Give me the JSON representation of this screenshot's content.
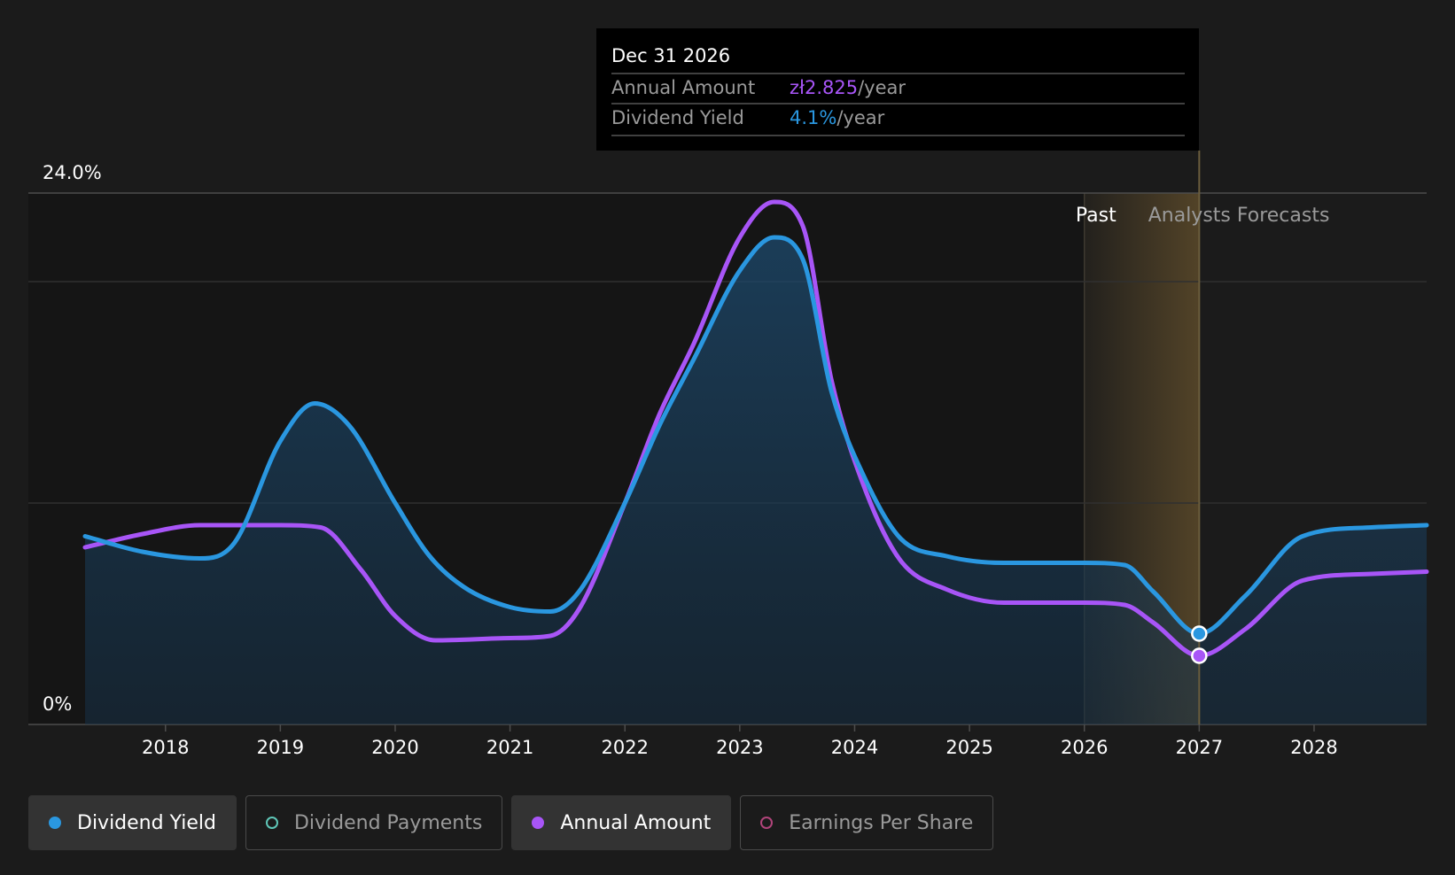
{
  "tooltip": {
    "date": "Dec 31 2026",
    "rows": [
      {
        "label": "Annual Amount",
        "value": "zł2.825",
        "unit": "/year",
        "color": "#a855f7"
      },
      {
        "label": "Dividend Yield",
        "value": "4.1%",
        "unit": "/year",
        "color": "#2a97e0"
      }
    ]
  },
  "regions": {
    "past_label": "Past",
    "forecast_label": "Analysts Forecasts"
  },
  "legend": [
    {
      "label": "Dividend Yield",
      "color": "#2a97e0",
      "style": "filled",
      "active": true
    },
    {
      "label": "Dividend Payments",
      "color": "#5fc7b8",
      "style": "hollow",
      "active": false
    },
    {
      "label": "Annual Amount",
      "color": "#a855f7",
      "style": "filled",
      "active": true
    },
    {
      "label": "Earnings Per Share",
      "color": "#b0447a",
      "style": "hollow",
      "active": false
    }
  ],
  "colors": {
    "dividend_yield": "#2a97e0",
    "annual_amount": "#a855f7",
    "background": "#1b1b1b",
    "forecast_band": "#5c4a2a"
  },
  "chart_data": {
    "type": "line",
    "x_range": [
      2017.3,
      2028.98
    ],
    "ylim": [
      0,
      24.0
    ],
    "y_tick_labels": [
      "0%",
      "24.0%"
    ],
    "x_tick_labels": [
      "2018",
      "2019",
      "2020",
      "2021",
      "2022",
      "2023",
      "2024",
      "2025",
      "2026",
      "2027",
      "2028"
    ],
    "x_ticks": [
      2018,
      2019,
      2020,
      2021,
      2022,
      2023,
      2024,
      2025,
      2026,
      2027,
      2028
    ],
    "grid_values": [
      10,
      20
    ],
    "past_end": 2026.0,
    "highlight_x": 2027.0,
    "grid": true,
    "series": [
      {
        "name": "Dividend Yield",
        "axis": "percent",
        "x": [
          2017.3,
          2017.8,
          2018.3,
          2018.6,
          2019.0,
          2019.3,
          2019.6,
          2020.0,
          2020.3,
          2020.6,
          2021.0,
          2021.35,
          2021.6,
          2022.0,
          2022.3,
          2022.6,
          2023.0,
          2023.3,
          2023.55,
          2023.8,
          2024.1,
          2024.4,
          2024.8,
          2025.3,
          2026.0,
          2026.35,
          2026.6,
          2027.0,
          2027.4,
          2027.9,
          2028.5,
          2028.98
        ],
        "y": [
          8.5,
          7.8,
          7.5,
          8.2,
          12.8,
          14.5,
          13.5,
          10.0,
          7.6,
          6.2,
          5.3,
          5.1,
          6.0,
          10.0,
          13.5,
          16.5,
          20.5,
          22.0,
          21.0,
          15.0,
          11.0,
          8.4,
          7.6,
          7.3,
          7.3,
          7.2,
          6.0,
          4.1,
          5.8,
          8.5,
          8.9,
          9.0
        ]
      },
      {
        "name": "Annual Amount",
        "axis": "scaled",
        "x": [
          2017.3,
          2017.8,
          2018.3,
          2019.0,
          2019.35,
          2019.7,
          2020.0,
          2020.35,
          2021.0,
          2021.35,
          2021.6,
          2022.0,
          2022.3,
          2022.6,
          2023.0,
          2023.3,
          2023.55,
          2023.8,
          2024.1,
          2024.4,
          2024.8,
          2025.3,
          2026.0,
          2026.35,
          2026.6,
          2027.0,
          2027.4,
          2027.9,
          2028.5,
          2028.98
        ],
        "y": [
          8.0,
          8.6,
          9.0,
          9.0,
          8.9,
          7.0,
          4.9,
          3.8,
          3.9,
          4.0,
          5.2,
          10.0,
          14.0,
          17.2,
          22.0,
          23.6,
          22.5,
          15.5,
          10.5,
          7.4,
          6.1,
          5.5,
          5.5,
          5.4,
          4.6,
          3.1,
          4.3,
          6.5,
          6.8,
          6.9
        ]
      }
    ]
  }
}
